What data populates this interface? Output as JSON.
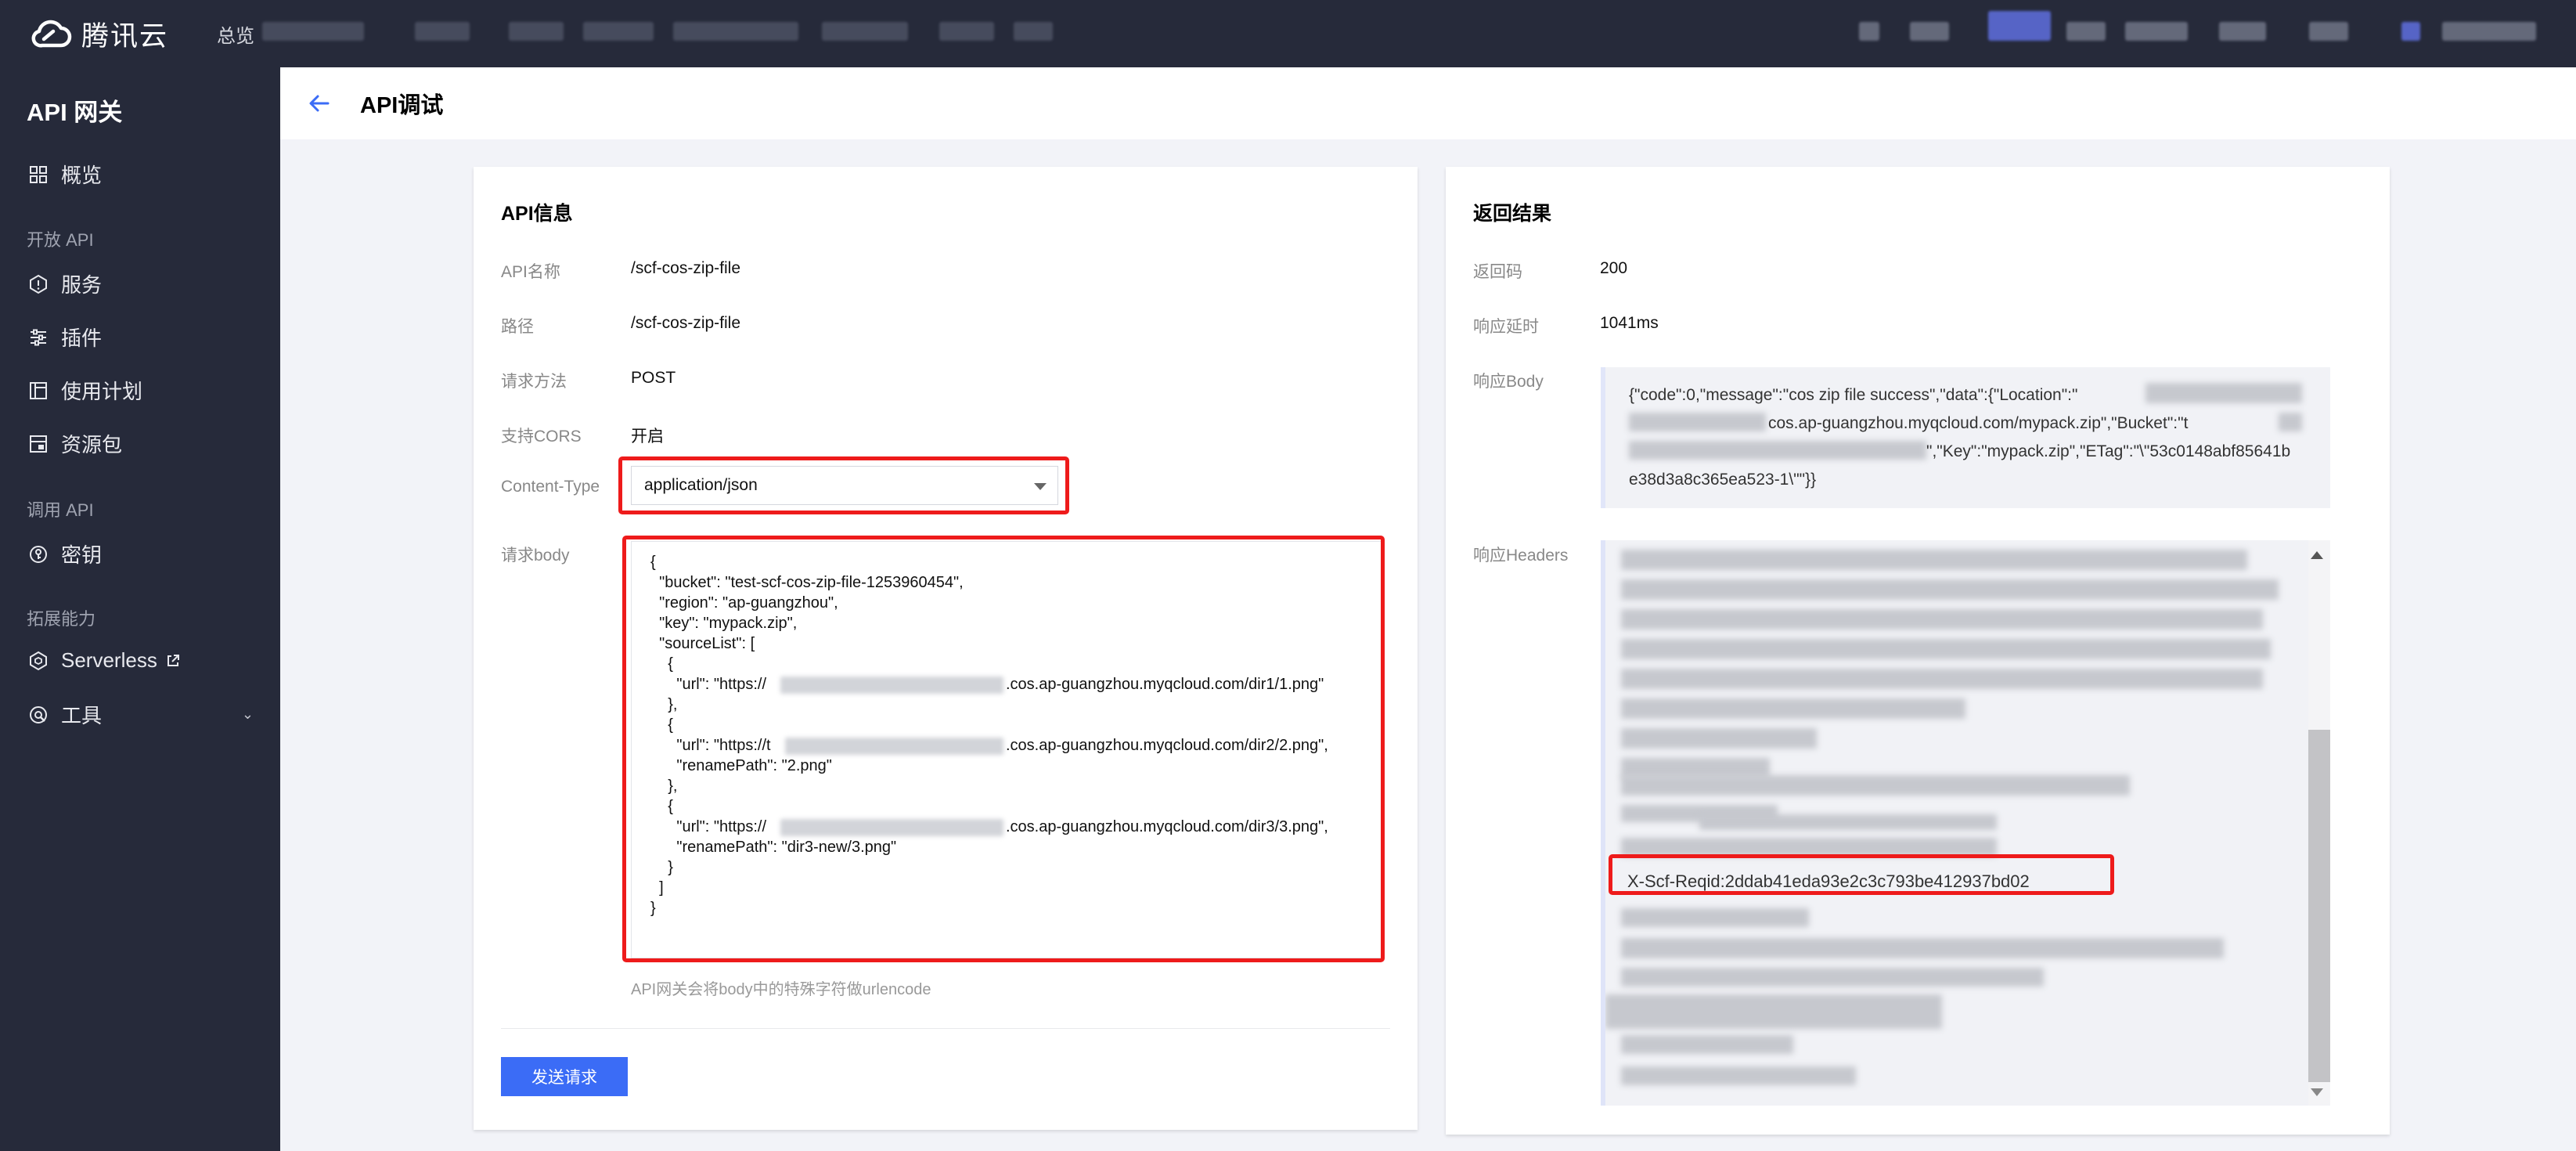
{
  "topbar": {
    "logo_text": "腾讯云",
    "home_label": "总览"
  },
  "sidebar": {
    "product_title": "API 网关",
    "items": [
      {
        "label": "概览",
        "icon": "grid-icon"
      },
      {
        "group": "开放 API"
      },
      {
        "label": "服务",
        "icon": "service-icon"
      },
      {
        "label": "插件",
        "icon": "plugin-icon"
      },
      {
        "label": "使用计划",
        "icon": "plan-icon"
      },
      {
        "label": "资源包",
        "icon": "package-icon"
      },
      {
        "group": "调用 API"
      },
      {
        "label": "密钥",
        "icon": "key-icon"
      },
      {
        "group": "拓展能力"
      },
      {
        "label": "Serverless",
        "icon": "serverless-icon",
        "external": true
      },
      {
        "label": "工具",
        "icon": "tool-icon",
        "expandable": true
      }
    ],
    "group_open_api": "开放 API",
    "group_call_api": "调用 API",
    "group_extend": "拓展能力",
    "overview": "概览",
    "service": "服务",
    "plugin": "插件",
    "plan": "使用计划",
    "package": "资源包",
    "key": "密钥",
    "serverless": "Serverless",
    "tools": "工具"
  },
  "header": {
    "title": "API调试"
  },
  "api_info": {
    "title": "API信息",
    "name_label": "API名称",
    "name_value": "/scf-cos-zip-file",
    "path_label": "路径",
    "path_value": "/scf-cos-zip-file",
    "method_label": "请求方法",
    "method_value": "POST",
    "cors_label": "支持CORS",
    "cors_value": "开启",
    "content_type_label": "Content-Type",
    "content_type_value": "application/json",
    "body_label": "请求body",
    "body_lines": [
      "{",
      "  \"bucket\": \"test-scf-cos-zip-file-1253960454\",",
      "  \"region\": \"ap-guangzhou\",",
      "  \"key\": \"mypack.zip\",",
      "  \"sourceList\": [",
      "    {",
      "      \"url\": \"https://",
      "    },",
      "    {",
      "      \"url\": \"https://t",
      "      \"renamePath\": \"2.png\"",
      "    },",
      "    {",
      "      \"url\": \"https://",
      "      \"renamePath\": \"dir3-new/3.png\"",
      "    }",
      "  ]",
      "}"
    ],
    "url_tails": [
      ".cos.ap-guangzhou.myqcloud.com/dir1/1.png\"",
      ".cos.ap-guangzhou.myqcloud.com/dir2/2.png\",",
      ".cos.ap-guangzhou.myqcloud.com/dir3/3.png\","
    ],
    "hint": "API网关会将body中的特殊字符做urlencode",
    "send_button": "发送请求"
  },
  "result": {
    "title": "返回结果",
    "code_label": "返回码",
    "code_value": "200",
    "latency_label": "响应延时",
    "latency_value": "1041ms",
    "body_label": "响应Body",
    "body_line1": "{\"code\":0,\"message\":\"cos zip file success\",\"data\":{\"Location\":\"",
    "body_line2": "cos.ap-guangzhou.myqcloud.com/mypack.zip\",\"Bucket\":\"t",
    "body_line3": "\",\"Key\":\"mypack.zip\",\"ETag\":\"\\\"53c0148abf85641b",
    "body_line4": "e38d3a8c365ea523-1\\\"\"}}",
    "headers_label": "响应Headers",
    "reqid": "X-Scf-Reqid:2ddab41eda93e2c3c793be412937bd02"
  },
  "colors": {
    "topbar_bg": "#262a3a",
    "accent": "#3b6cf6",
    "highlight": "#ee1b1b"
  }
}
